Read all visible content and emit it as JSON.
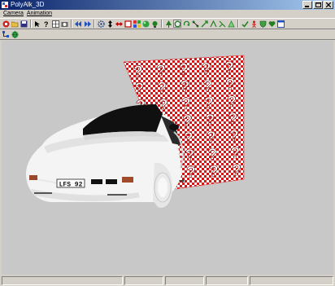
{
  "window": {
    "title": "PolyAlk_3D"
  },
  "menu": {
    "items": [
      "Camera",
      "Animation"
    ]
  },
  "scene": {
    "plate_text": "LFS 92",
    "texture_glyph": "?"
  },
  "colors": {
    "checker_red": "#d01818",
    "checker_white": "#ffffff",
    "car_body": "#f4f4f4",
    "background": "#c8c8c8"
  }
}
